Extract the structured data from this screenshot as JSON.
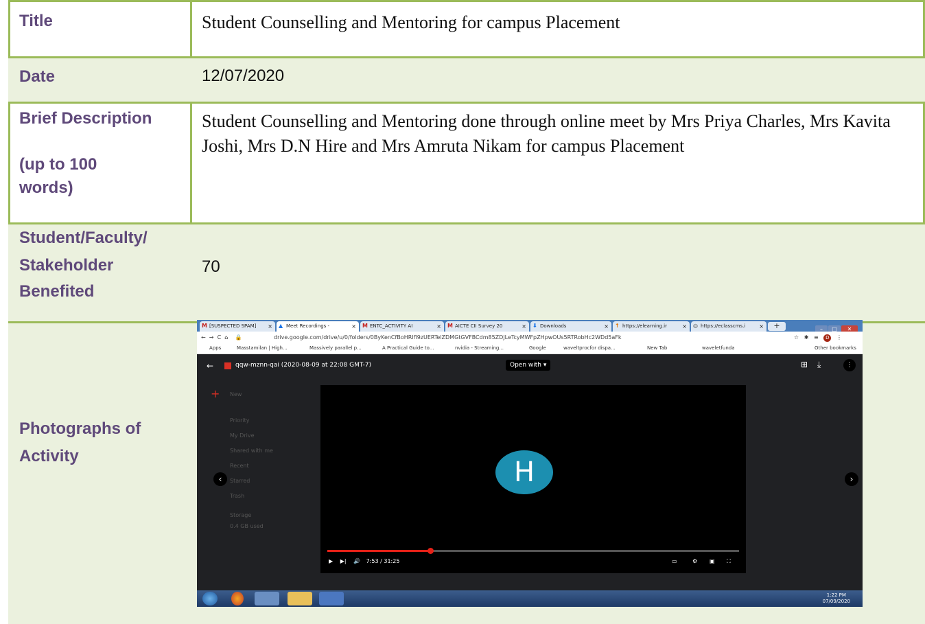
{
  "rows": [
    {
      "label": "Title",
      "value": "Student Counselling and Mentoring for campus Placement"
    },
    {
      "label": "Date",
      "value": "12/07/2020"
    },
    {
      "label": "Brief Description",
      "label2": "(up to 100",
      "label3": "words)",
      "value": "Student Counselling and Mentoring done through online meet by Mrs Priya Charles, Mrs Kavita Joshi, Mrs D.N Hire and Mrs Amruta Nikam for campus Placement"
    },
    {
      "label": "Student/Faculty/",
      "label2": "Stakeholder",
      "label3": "Benefited",
      "value": "70"
    },
    {
      "label": "Photographs of",
      "label2": "Activity"
    }
  ],
  "screenshot": {
    "tabs": [
      "[SUSPECTED SPAM]",
      "Meet Recordings -",
      "ENTC_ACTIVITY AI",
      "AICTE CII Survey 20",
      "Downloads",
      "https://elearning.ir",
      "https://eclasscms.i"
    ],
    "url": "drive.google.com/drive/u/0/folders/0ByKenCfBoHRIfl9zUERTelZDMGtGVFBCdm85ZDJLeTcyMWFpZHpwOUs5RTRobHc2WDd5aFk",
    "bookmarks": [
      "Apps",
      "Masstamilan | High...",
      "Massively parallel p...",
      "A Practical Guide to...",
      "nvidia - Streaming...",
      "Google",
      "waveltprocfor dispa...",
      "New Tab",
      "waveletfunda",
      "Other bookmarks"
    ],
    "file_title": "qqw-mznn-qai (2020-08-09 at 22:08 GMT-7)",
    "open_with": "Open with",
    "avatar_letter": "H",
    "time": "7:53 / 31:25",
    "drive_new": "New",
    "drive_items": [
      "Priority",
      "My Drive",
      "Shared with me",
      "Recent",
      "Starred",
      "Trash",
      "Storage",
      "0.4 GB used"
    ],
    "clock_time": "1:22 PM",
    "clock_date": "07/09/2020",
    "progress_fraction": 0.25
  }
}
